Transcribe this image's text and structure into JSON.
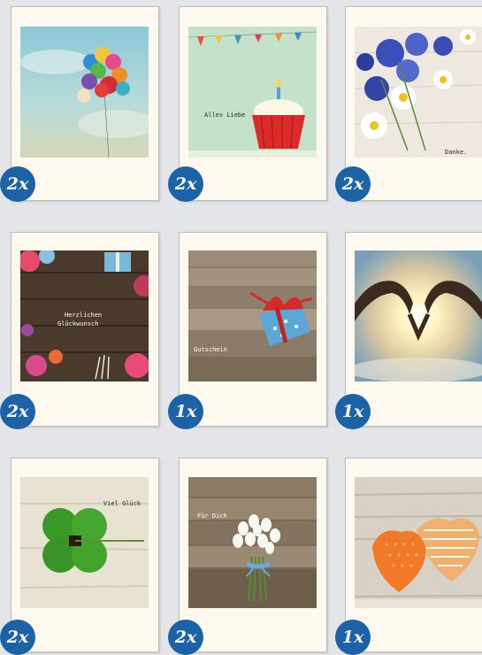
{
  "cards": [
    {
      "quantity": "2x",
      "caption": "",
      "photo": "balloons"
    },
    {
      "quantity": "2x",
      "caption": "Alles Liebe",
      "photo": "cupcake"
    },
    {
      "quantity": "2x",
      "caption": "Danke.",
      "photo": "cornflowers"
    },
    {
      "quantity": "2x",
      "caption": "Herzlichen Glückwunsch",
      "caption_line1": "Herzlichen",
      "caption_line2": "Glückwunsch",
      "photo": "lollipops"
    },
    {
      "quantity": "1x",
      "caption": "Gutschein",
      "photo": "gift"
    },
    {
      "quantity": "1x",
      "caption": "",
      "photo": "heart-hands"
    },
    {
      "quantity": "2x",
      "caption": "Viel Glück",
      "photo": "clover"
    },
    {
      "quantity": "2x",
      "caption": "Für Dich",
      "photo": "snowdrops"
    },
    {
      "quantity": "1x",
      "caption": "",
      "photo": "fabric-hearts"
    }
  ],
  "colors": {
    "badge": "#1c62a6",
    "card": "#fdf9ee",
    "background": "#e3e5e8"
  }
}
